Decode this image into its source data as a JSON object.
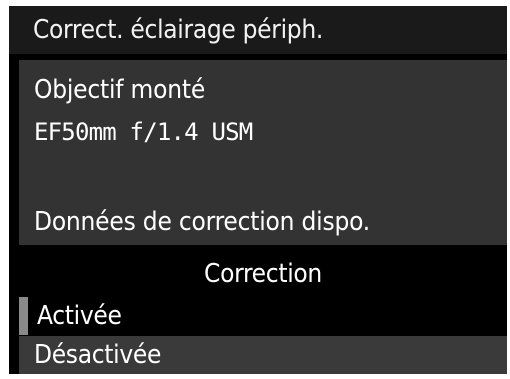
{
  "screen": {
    "title": "Correct. éclairage périph."
  },
  "lens_info": {
    "label": "Objectif monté",
    "lens_name": "EF50mm f/1.4 USM",
    "status": "Données de correction dispo."
  },
  "correction": {
    "header": "Correction",
    "options": [
      {
        "label": "Activée",
        "selected": true
      },
      {
        "label": "Désactivée",
        "selected": false
      }
    ]
  },
  "colors": {
    "background": "#000000",
    "title_bar": "#1a1a1a",
    "panel": "#333333",
    "option_unselected": "#3a3a3a",
    "text": "#ffffff",
    "selection_marker": "#8a8a8a"
  }
}
